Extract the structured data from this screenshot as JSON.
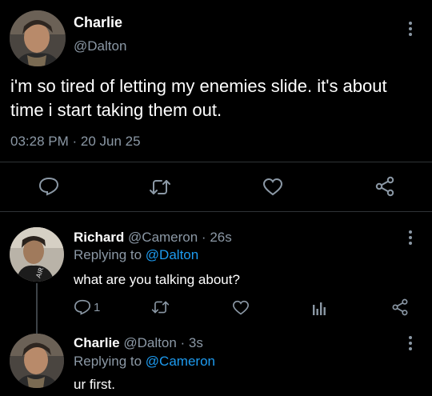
{
  "main_tweet": {
    "display_name": "Charlie",
    "handle": "@Dalton",
    "text": "i'm so tired of letting my enemies slide. it's about time i start taking them out.",
    "timestamp": "03:28 PM · 20 Jun 25",
    "actions": [
      "reply-icon",
      "retweet-icon",
      "like-icon",
      "share-icon"
    ]
  },
  "replies": [
    {
      "display_name": "Richard",
      "meta": "@Cameron · 26s",
      "replying_label": "Replying to",
      "replying_to": "@Dalton",
      "text": "what are you talking about?",
      "reply_count": "1"
    },
    {
      "display_name": "Charlie",
      "meta": "@Dalton · 3s",
      "replying_label": "Replying to",
      "replying_to": "@Cameron",
      "text": "ur first."
    }
  ],
  "colors": {
    "background": "#000000",
    "text": "#e7e9ea",
    "secondary": "#8b98a5",
    "link": "#1d9bf0",
    "divider": "#2f3336"
  }
}
